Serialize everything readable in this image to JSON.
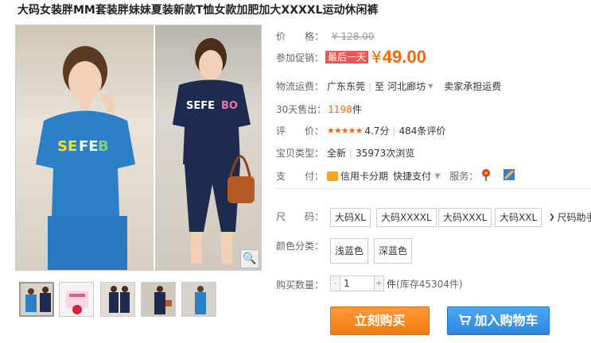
{
  "title": "大码女装胖MM套装胖妹妹夏装新款T恤女款加肥加大XXXXL运动休闲裤",
  "price": {
    "label": "价　　格：",
    "value": "¥ 128.00"
  },
  "promo": {
    "label": "参加促销：",
    "tag": "最后一天",
    "yen": "¥",
    "value": "49.00"
  },
  "shipping": {
    "label": "物流运费：",
    "from": "广东东莞",
    "sep": "|",
    "to_prefix": "至",
    "to": "河北廊坊",
    "note": "卖家承担运费"
  },
  "sold": {
    "label": "30天售出：",
    "count": "1198",
    "unit": "件"
  },
  "rating": {
    "label": "评　　价：",
    "stars": "★★★★★",
    "score": "4.7分",
    "sep": "|",
    "reviews": "484条评价"
  },
  "type": {
    "label": "宝贝类型：",
    "value": "全新",
    "sep": "|",
    "views": "35973次浏览"
  },
  "payment": {
    "label": "支　　付：",
    "credit": "信用卡分期",
    "quick": "快捷支付",
    "service_label": "服务："
  },
  "size": {
    "label": "尺　　码：",
    "options": [
      "大码XL",
      "大码XXXXL",
      "大码XXXL",
      "大码XXL"
    ],
    "guide": "尺码助手"
  },
  "color": {
    "label": "颜色分类：",
    "options": [
      "浅蓝色",
      "深蓝色"
    ]
  },
  "quantity": {
    "label": "购买数量：",
    "minus": "-",
    "value": "1",
    "plus": "+",
    "unit": "件",
    "stock": "(库存45304件)"
  },
  "actions": {
    "buy": "立刻购买",
    "cart": "加入购物车"
  },
  "colors": {
    "accent": "#ff6600",
    "buy": "#f27b10",
    "cart": "#2b86dd"
  }
}
